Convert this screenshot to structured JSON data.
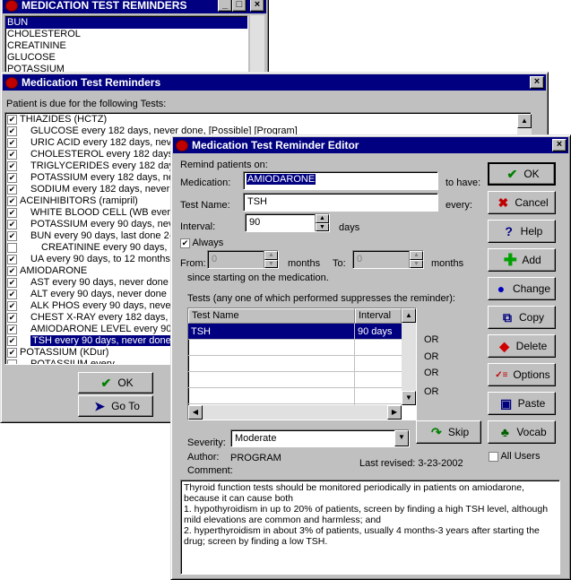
{
  "w1": {
    "title": "MEDICATION TEST REMINDERS",
    "items": [
      "BUN",
      "CHOLESTEROL",
      "CREATININE",
      "GLUCOSE",
      "POTASSIUM"
    ]
  },
  "w2": {
    "title": "Medication Test Reminders",
    "prompt": "Patient is due for the following Tests:",
    "rows": [
      {
        "text": "THIAZIDES (HCTZ)",
        "indent": 0,
        "checked": true
      },
      {
        "text": "GLUCOSE every 182 days, never done, [Possible] [Program]",
        "indent": 1,
        "checked": true
      },
      {
        "text": "URIC ACID every 182 days, never",
        "indent": 1,
        "checked": true
      },
      {
        "text": "CHOLESTEROL every 182 days,",
        "indent": 1,
        "checked": true
      },
      {
        "text": "TRIGLYCERIDES every 182 days,",
        "indent": 1,
        "checked": true
      },
      {
        "text": "POTASSIUM every 182 days, never",
        "indent": 1,
        "checked": true
      },
      {
        "text": "SODIUM every 182 days, never",
        "indent": 1,
        "checked": true
      },
      {
        "text": "ACEINHIBITORS (ramipril)",
        "indent": 0,
        "checked": true
      },
      {
        "text": "WHITE BLOOD CELL (WB every",
        "indent": 1,
        "checked": true
      },
      {
        "text": "POTASSIUM every 90 days, never",
        "indent": 1,
        "checked": true
      },
      {
        "text": "BUN every 90 days, last done 2-",
        "indent": 1,
        "checked": true
      },
      {
        "text": "CREATININE every 90 days, la",
        "indent": 2,
        "checked": false
      },
      {
        "text": "UA every 90 days, to 12 months;",
        "indent": 1,
        "checked": true
      },
      {
        "text": "AMIODARONE",
        "indent": 0,
        "checked": true
      },
      {
        "text": "AST every 90 days, never done",
        "indent": 1,
        "checked": true
      },
      {
        "text": "ALT every 90 days, never done",
        "indent": 1,
        "checked": true
      },
      {
        "text": "ALK PHOS every 90 days, never",
        "indent": 1,
        "checked": true
      },
      {
        "text": "CHEST X-RAY every 182 days, l",
        "indent": 1,
        "checked": true
      },
      {
        "text": "AMIODARONE LEVEL every 90",
        "indent": 1,
        "checked": true
      },
      {
        "text": "TSH every 90 days, never done",
        "indent": 1,
        "checked": true,
        "selected": true
      },
      {
        "text": "POTASSIUM (KDur)",
        "indent": 0,
        "checked": true
      },
      {
        "text": "POTASSIUM every",
        "indent": 1,
        "checked": false
      }
    ],
    "ok_label": "OK",
    "goto_label": "Go To"
  },
  "ed": {
    "title": "Medication Test Reminder Editor",
    "remind_label": "Remind patients on:",
    "medication_label": "Medication:",
    "medication_value": "AMIODARONE",
    "to_have": "to have:",
    "testname_label": "Test Name:",
    "testname_value": "TSH",
    "every": "every:",
    "interval_label": "Interval:",
    "interval_value": "90",
    "days": "days",
    "always_label": "Always",
    "from_label": "From:",
    "from_value": "0",
    "months1": "months",
    "to_label": "To:",
    "to_value": "0",
    "months2": "months",
    "since": "since starting on the medication.",
    "tests_caption": "Tests (any one of which  performed suppresses the reminder):",
    "grid_headers": [
      "Test Name",
      "Interval"
    ],
    "grid_rows": [
      [
        "TSH",
        "90 days"
      ]
    ],
    "or_labels": [
      "OR",
      "OR",
      "OR",
      "OR"
    ],
    "severity_label": "Severity:",
    "severity_value": "Moderate",
    "author_label": "Author:",
    "author_value": "PROGRAM",
    "comment_label": "Comment:",
    "last_revised": "Last revised: 3-23-2002",
    "all_users": "All Users",
    "comment": "Thyroid function tests should be monitored periodically in patients on amiodarone, because it can cause both\n1. hypothyroidism in up to 20% of patients, screen by finding a high TSH level, although mild elevations are common and harmless; and\n2. hyperthyroidism in about 3% of patients, usually 4 months-3 years after starting the drug; screen by finding a low TSH.",
    "buttons": {
      "ok": "OK",
      "cancel": "Cancel",
      "help": "Help",
      "add": "Add",
      "change": "Change",
      "copy": "Copy",
      "delete": "Delete",
      "options": "Options",
      "paste": "Paste",
      "skip": "Skip",
      "vocab": "Vocab"
    }
  }
}
